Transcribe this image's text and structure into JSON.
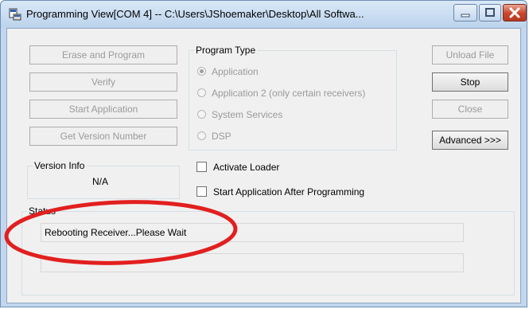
{
  "window": {
    "title": "Programming View[COM 4] -- C:\\Users\\JShoemaker\\Desktop\\All Softwa...",
    "controls": {
      "minimize": "minimize-icon",
      "maximize": "maximize-icon",
      "close": "close-icon"
    },
    "colors": {
      "frame": "#c2d7ee",
      "close_button": "#c9442a",
      "annotation_circle": "#e21f1f"
    }
  },
  "left_buttons": {
    "erase_and_program": "Erase and Program",
    "verify": "Verify",
    "start_application": "Start Application",
    "get_version_number": "Get Version Number"
  },
  "program_type": {
    "label": "Program Type",
    "options": [
      {
        "label": "Application",
        "selected": true
      },
      {
        "label": "Application 2 (only certain receivers)",
        "selected": false
      },
      {
        "label": "System Services",
        "selected": false
      },
      {
        "label": "DSP",
        "selected": false
      }
    ]
  },
  "right_buttons": {
    "unload_file": "Unload File",
    "stop": "Stop",
    "close": "Close",
    "advanced": "Advanced >>>"
  },
  "version_info": {
    "label": "Version Info",
    "value": "N/A"
  },
  "checkboxes": {
    "activate_loader": {
      "label": "Activate Loader",
      "checked": false
    },
    "start_after_programming": {
      "label": "Start Application After Programming",
      "checked": false
    }
  },
  "status": {
    "label": "Status",
    "line1": "Rebooting Receiver...Please Wait",
    "line2": ""
  }
}
